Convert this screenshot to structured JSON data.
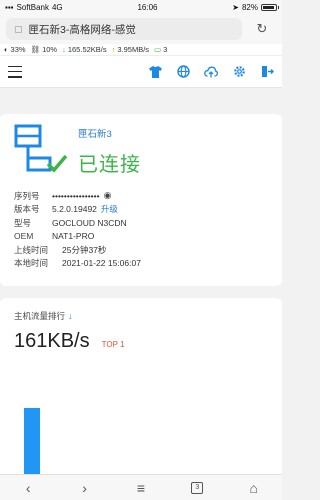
{
  "status_bar": {
    "carrier": "SoftBank",
    "network": "4G",
    "time": "16:06",
    "battery_text": "82%",
    "battery_level": 0.82
  },
  "address_bar": {
    "title": "匣石新3-高格网络-感觉"
  },
  "speed_bar": {
    "cpu": "33%",
    "mem": "10%",
    "down_speed": "165.52KB/s",
    "up_speed": "3.95MB/s",
    "devices": "3"
  },
  "toolbar": {
    "icons": [
      "shirt-icon",
      "globe-icon",
      "upload-cloud-icon",
      "gear-icon",
      "export-icon"
    ]
  },
  "device": {
    "name": "匣石新3",
    "status": "已连接",
    "rows": [
      {
        "label": "序列号",
        "value": "••••••••••••••••"
      },
      {
        "label": "版本号",
        "value": "5.2.0.19492",
        "action": "升级"
      },
      {
        "label": "型号",
        "value": "GOCLOUD N3CDN"
      },
      {
        "label": "OEM",
        "value": "NAT1-PRO"
      },
      {
        "label": "上线时间",
        "value": "25分钟37秒"
      },
      {
        "label": "本地时间",
        "value": "2021-01-22 15:06:07"
      }
    ]
  },
  "traffic": {
    "title": "主机流量排行",
    "value": "161KB/s",
    "badge": "TOP 1"
  },
  "chart_data": {
    "type": "bar",
    "categories": [
      "",
      ""
    ],
    "values": [
      161,
      2
    ],
    "ylim": [
      0,
      230
    ],
    "colors": [
      "#2196f3",
      "#2196f3"
    ]
  },
  "bottom_nav": {
    "tabs": "3"
  },
  "colors": {
    "accent": "#1e88e5",
    "status_green": "#3bb44a",
    "top_badge": "#e2533b"
  }
}
